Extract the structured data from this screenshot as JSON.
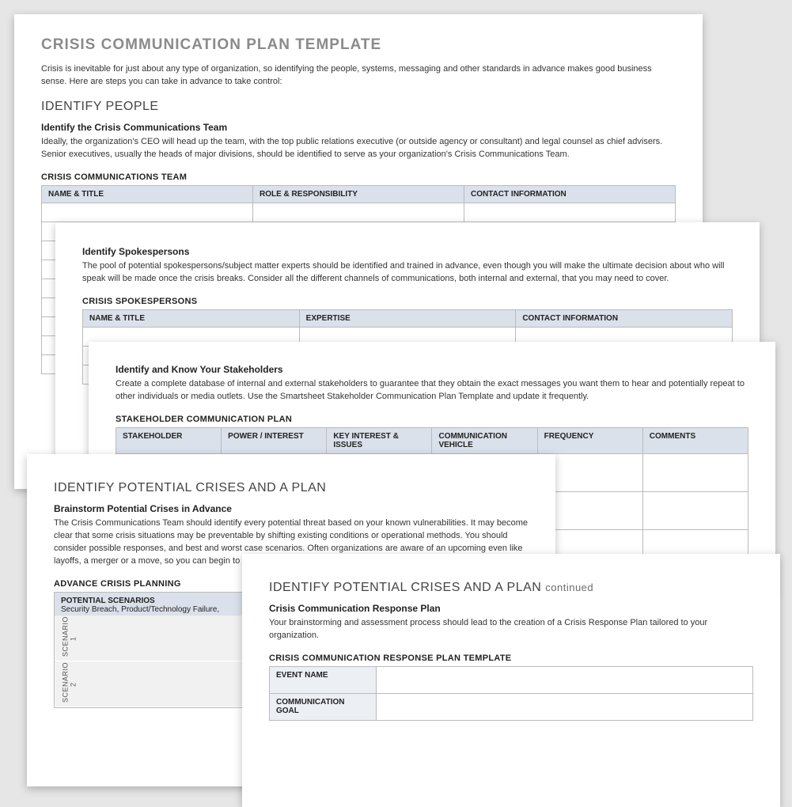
{
  "page1": {
    "title": "CRISIS COMMUNICATION PLAN TEMPLATE",
    "intro": "Crisis is inevitable for just about any type of organization, so identifying the people, systems, messaging and other standards in advance makes good business sense. Here are steps you can take in advance to take control:",
    "h2": "IDENTIFY PEOPLE",
    "sub": "Identify the Crisis Communications Team",
    "body": "Ideally, the organization's CEO will head up the team, with the top public relations executive (or outside agency or consultant) and legal counsel as chief advisers. Senior executives, usually the heads of major divisions, should be identified to serve as your organization's Crisis Communications Team.",
    "table_title": "CRISIS COMMUNICATIONS TEAM",
    "headers": {
      "a": "NAME & TITLE",
      "b": "ROLE & RESPONSIBILITY",
      "c": "CONTACT INFORMATION"
    }
  },
  "page2": {
    "sub": "Identify Spokespersons",
    "body": "The pool of potential spokespersons/subject matter experts should be identified and trained in advance, even though you will make the ultimate decision about who will speak will be made once the crisis breaks. Consider all the different channels of communications, both internal and external, that you may need to cover.",
    "table_title": "CRISIS SPOKESPERSONS",
    "headers": {
      "a": "NAME & TITLE",
      "b": "EXPERTISE",
      "c": "CONTACT INFORMATION"
    }
  },
  "page3": {
    "sub": "Identify and Know Your Stakeholders",
    "body": "Create a complete database of internal and external stakeholders to guarantee that they obtain the exact messages you want them to hear and potentially repeat to other individuals or media outlets. Use the Smartsheet Stakeholder Communication Plan Template and update it frequently.",
    "table_title": "STAKEHOLDER COMMUNICATION PLAN",
    "headers": {
      "a": "STAKEHOLDER",
      "b": "POWER / INTEREST",
      "c": "KEY INTEREST & ISSUES",
      "d": "COMMUNICATION VEHICLE",
      "e": "FREQUENCY",
      "f": "COMMENTS"
    }
  },
  "page4": {
    "h2": "IDENTIFY POTENTIAL CRISES AND A PLAN",
    "sub": "Brainstorm Potential Crises in Advance",
    "body": "The Crisis Communications Team should identify every potential threat based on your known vulnerabilities. It may become clear that some crisis situations may be preventable by shifting existing conditions or operational methods. You should consider possible responses, and best and worst case scenarios. Often organizations are aware of an upcoming even like layoffs, a merger or a move, so you can begin to plan well in advance of the actual event.",
    "table_title": "ADVANCE CRISIS PLANNING",
    "scenarios_header": "POTENTIAL SCENARIOS",
    "scenarios_sub": "Security Breach, Product/Technology Failure,",
    "row1": "SCENARIO 1",
    "row2": "SCENARIO 2"
  },
  "page5": {
    "h2": "IDENTIFY POTENTIAL CRISES AND A PLAN",
    "cont": "continued",
    "sub": "Crisis Communication Response Plan",
    "body": "Your brainstorming and assessment process should lead to the creation of a Crisis Response Plan tailored to your organization.",
    "table_title": "CRISIS COMMUNICATION RESPONSE PLAN TEMPLATE",
    "rows": {
      "a": "EVENT NAME",
      "b": "COMMUNICATION GOAL"
    }
  }
}
